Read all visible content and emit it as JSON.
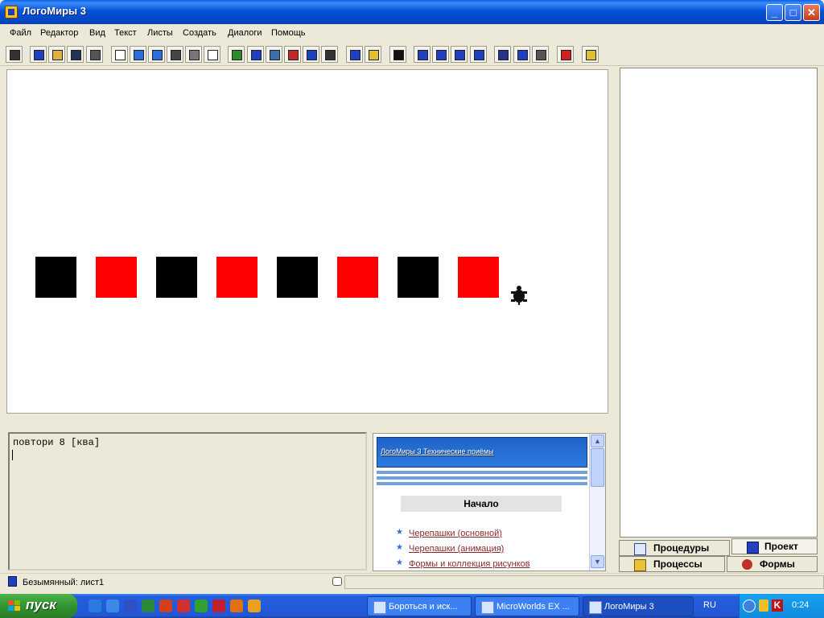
{
  "window": {
    "title": "ЛогоМиры 3"
  },
  "menu": [
    "Файл",
    "Редактор",
    "Вид",
    "Текст",
    "Листы",
    "Создать",
    "Диалоги",
    "Помощь"
  ],
  "toolbar": {
    "icons": [
      "pointer-icon",
      "project-icon",
      "open-icon",
      "save-icon",
      "print-icon",
      "new-page-icon",
      "arrow-left-icon",
      "arrow-right-icon",
      "window-icon",
      "grid-icon",
      "rectangle-icon",
      "turtle-icon",
      "text-box-icon",
      "slider-icon",
      "button-icon",
      "music-icon",
      "draw-icon",
      "paste-icon",
      "paint-icon",
      "select-icon",
      "stamp-icon",
      "zoom-in-icon",
      "zoom-out-icon",
      "eye-icon",
      "cut-icon",
      "copy-icon",
      "clipboard-icon",
      "stop-icon",
      "help-icon"
    ]
  },
  "canvas": {
    "squares": [
      {
        "color": "#000000"
      },
      {
        "color": "#ff0000"
      },
      {
        "color": "#000000"
      },
      {
        "color": "#ff0000"
      },
      {
        "color": "#000000"
      },
      {
        "color": "#ff0000"
      },
      {
        "color": "#000000"
      },
      {
        "color": "#ff0000"
      }
    ]
  },
  "command_center": {
    "text": "повтори 8 [ква]"
  },
  "help": {
    "banner": "ЛогоМиры 3 Технические приёмы",
    "heading": "Начало",
    "links": [
      "Черепашки (основной)",
      "Черепашки (анимация)",
      "Формы и коллекция рисунков"
    ]
  },
  "tabs": {
    "procedures": "Процедуры",
    "project": "Проект",
    "processes": "Процессы",
    "shapes": "Формы"
  },
  "status": {
    "text": "Безымянный:  лист1"
  },
  "taskbar": {
    "start": "пуск",
    "tasks": [
      "Бороться и иск...",
      "MicroWorlds EX ...",
      "ЛогоМиры 3"
    ],
    "lang": "RU",
    "clock": "0:24"
  },
  "colors": {
    "accent": "#0a5fe8",
    "link": "#8a2a2a",
    "taskbar": "#245edb"
  }
}
